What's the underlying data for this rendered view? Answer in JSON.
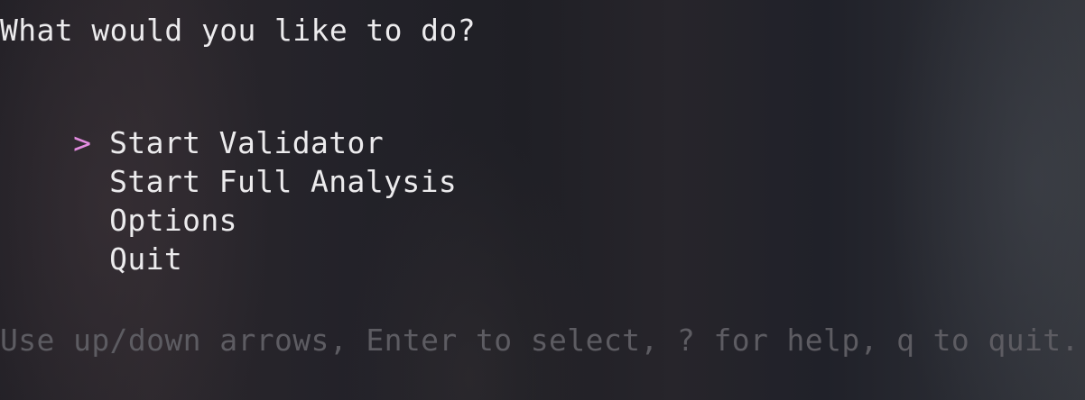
{
  "prompt": {
    "question": "What would you like to do?"
  },
  "menu": {
    "cursor_symbol": ">",
    "selected_index": 0,
    "items": [
      {
        "label": "Start Validator"
      },
      {
        "label": "Start Full Analysis"
      },
      {
        "label": "Options"
      },
      {
        "label": "Quit"
      }
    ]
  },
  "footer": {
    "hint": "Use up/down arrows, Enter to select, ? for help, q to quit."
  },
  "colors": {
    "cursor": "#e38be0",
    "text": "#ecebed",
    "hint": "#5d5c62"
  }
}
